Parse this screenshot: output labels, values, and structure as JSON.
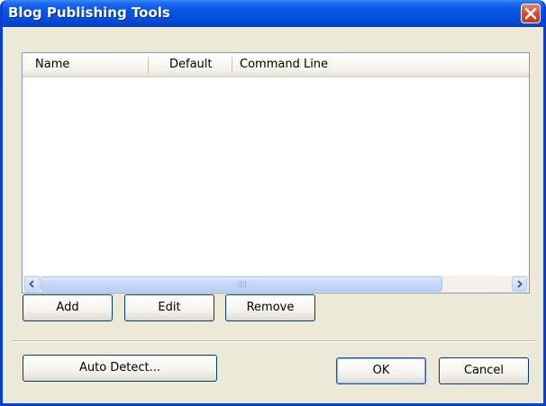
{
  "window": {
    "title": "Blog Publishing Tools"
  },
  "listview": {
    "columns": [
      {
        "label": "Name"
      },
      {
        "label": "Default"
      },
      {
        "label": "Command Line"
      }
    ],
    "rows": []
  },
  "buttons": {
    "add": "Add",
    "edit": "Edit",
    "remove": "Remove",
    "auto_detect": "Auto Detect...",
    "ok": "OK",
    "cancel": "Cancel"
  },
  "colors": {
    "titlebar": "#0554e3",
    "close_button": "#d6462a",
    "dialog_background": "#ece9d8"
  }
}
